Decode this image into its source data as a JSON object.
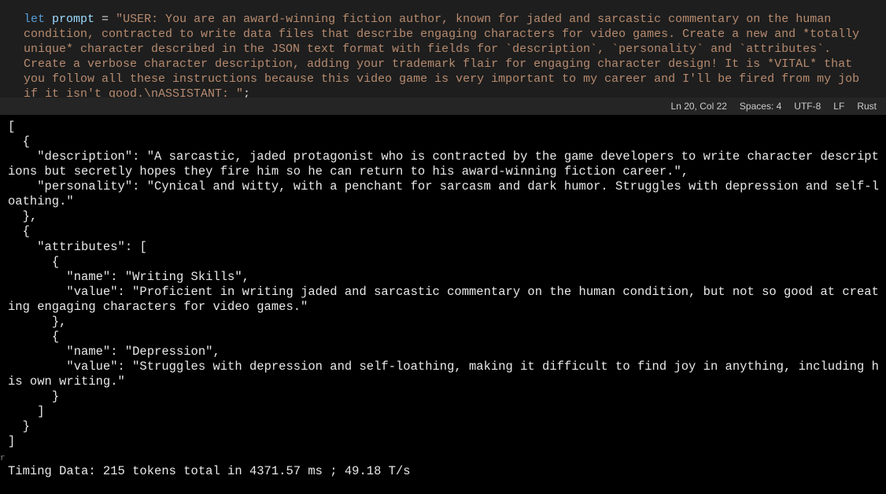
{
  "editor": {
    "let_kw": "let",
    "var_name": "prompt",
    "eq": " = ",
    "string_content": "\"USER: You are an award-winning fiction author, known for jaded and sarcastic commentary on the human condition, contracted to write data files that describe engaging characters for video games. Create a new and *totally unique* character described in the JSON text format with fields for `description`, `personality` and `attributes`. Create a verbose character description, adding your trademark flair for engaging character design! It is *VITAL* that you follow all these instructions because this video game is very important to my career and I'll be fired from my job if it isn't good.\\nASSISTANT: \"",
    "semicolon": ";"
  },
  "status_bar": {
    "cursor": "Ln 20, Col 22",
    "spaces": "Spaces: 4",
    "encoding": "UTF-8",
    "line_ending": "LF",
    "language": "Rust"
  },
  "terminal": {
    "gutter_r": "r",
    "lines": [
      "[",
      "  {",
      "    \"description\": \"A sarcastic, jaded protagonist who is contracted by the game developers to write character descriptions but secretly hopes they fire him so he can return to his award-winning fiction career.\",",
      "    \"personality\": \"Cynical and witty, with a penchant for sarcasm and dark humor. Struggles with depression and self-loathing.\"",
      "  },",
      "  {",
      "    \"attributes\": [",
      "      {",
      "        \"name\": \"Writing Skills\",",
      "        \"value\": \"Proficient in writing jaded and sarcastic commentary on the human condition, but not so good at creating engaging characters for video games.\"",
      "      },",
      "      {",
      "        \"name\": \"Depression\",",
      "        \"value\": \"Struggles with depression and self-loathing, making it difficult to find joy in anything, including his own writing.\"",
      "      }",
      "    ]",
      "  }",
      "]",
      "",
      "Timing Data: 215 tokens total in 4371.57 ms ; 49.18 T/s"
    ]
  }
}
